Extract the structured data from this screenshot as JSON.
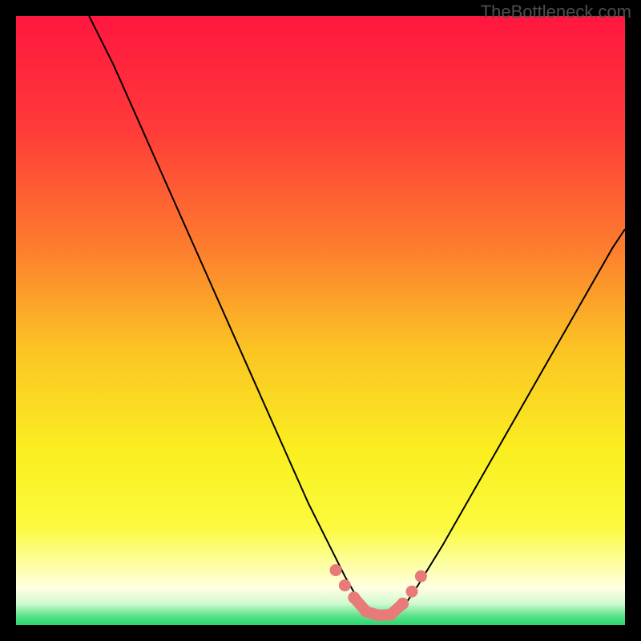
{
  "watermark": "TheBottleneck.com",
  "colors": {
    "frame": "#000000",
    "gradient_stops": [
      {
        "offset": 0.0,
        "color": "#ff173f"
      },
      {
        "offset": 0.18,
        "color": "#ff3939"
      },
      {
        "offset": 0.38,
        "color": "#fd7d2e"
      },
      {
        "offset": 0.55,
        "color": "#fbc524"
      },
      {
        "offset": 0.72,
        "color": "#faf020"
      },
      {
        "offset": 0.84,
        "color": "#fbfa3e"
      },
      {
        "offset": 0.9,
        "color": "#fdfea1"
      },
      {
        "offset": 0.94,
        "color": "#ffffe4"
      },
      {
        "offset": 0.965,
        "color": "#d0f9d0"
      },
      {
        "offset": 0.985,
        "color": "#5be389"
      },
      {
        "offset": 1.0,
        "color": "#2dd66f"
      }
    ],
    "curve": "#000000",
    "band": "#e87a7a"
  },
  "chart_data": {
    "type": "line",
    "title": "",
    "xlabel": "",
    "ylabel": "",
    "xlim": [
      0,
      100
    ],
    "ylim": [
      0,
      100
    ],
    "description": "Bottleneck curve — V-shaped line on a vertical red→yellow→green heat gradient. Y axis is bottleneck severity (top = worst / red, bottom = optimal / green). X axis is the balance between two components. The curve minimum (near-zero bottleneck) lies around x≈57–62 and is highlighted with a pink band.",
    "series": [
      {
        "name": "bottleneck-curve",
        "x": [
          12,
          16,
          20,
          24,
          28,
          32,
          36,
          40,
          44,
          48,
          50,
          52,
          54,
          56,
          58,
          60,
          62,
          64,
          66,
          70,
          74,
          78,
          82,
          86,
          90,
          94,
          98,
          100
        ],
        "y": [
          100,
          92,
          83,
          74,
          65,
          56,
          47,
          38,
          29,
          20,
          16,
          12,
          8,
          4.5,
          2.2,
          1.4,
          1.7,
          3.5,
          6.5,
          13,
          20,
          27,
          34,
          41,
          48,
          55,
          62,
          65
        ]
      }
    ],
    "optimal_band": {
      "x_range": [
        52,
        67
      ],
      "y_range": [
        1.2,
        9
      ],
      "points": [
        {
          "x": 52.5,
          "y": 9.0
        },
        {
          "x": 54.0,
          "y": 6.5
        },
        {
          "x": 55.5,
          "y": 4.5
        },
        {
          "x": 57.5,
          "y": 2.2
        },
        {
          "x": 59.5,
          "y": 1.6
        },
        {
          "x": 61.5,
          "y": 1.7
        },
        {
          "x": 63.5,
          "y": 3.5
        },
        {
          "x": 65.0,
          "y": 5.5
        },
        {
          "x": 66.5,
          "y": 8.0
        }
      ]
    }
  }
}
